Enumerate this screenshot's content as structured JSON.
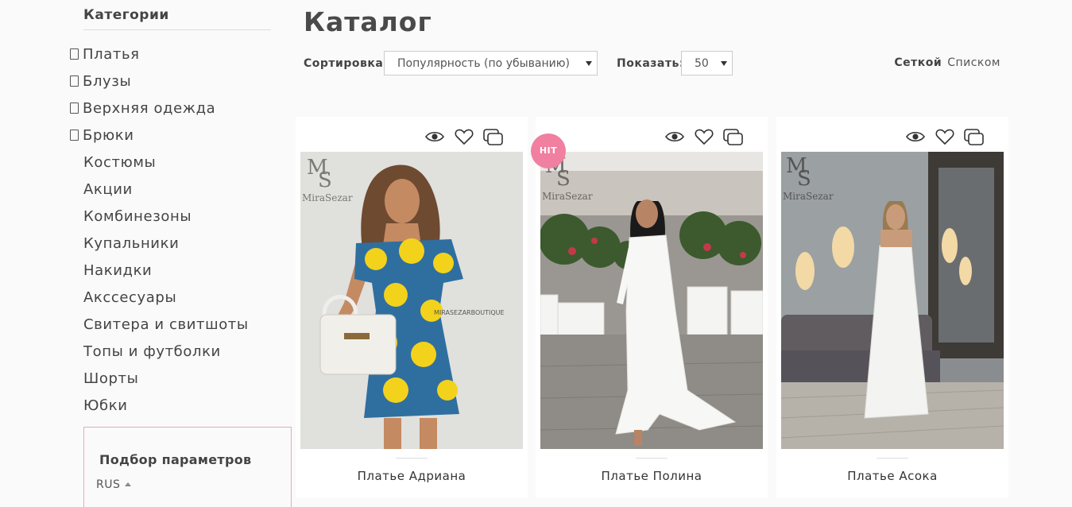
{
  "sidebar": {
    "title": "Категории",
    "items": [
      {
        "label": "Платья",
        "expandable": true
      },
      {
        "label": "Блузы",
        "expandable": true
      },
      {
        "label": "Верхняя одежда",
        "expandable": true
      },
      {
        "label": "Брюки",
        "expandable": true
      },
      {
        "label": "Костюмы",
        "expandable": false
      },
      {
        "label": "Акции",
        "expandable": false
      },
      {
        "label": "Комбинезоны",
        "expandable": false
      },
      {
        "label": "Купальники",
        "expandable": false
      },
      {
        "label": "Накидки",
        "expandable": false
      },
      {
        "label": "Акссесуары",
        "expandable": false
      },
      {
        "label": "Свитера и свитшоты",
        "expandable": false
      },
      {
        "label": "Топы и футболки",
        "expandable": false
      },
      {
        "label": "Шорты",
        "expandable": false
      },
      {
        "label": "Юбки",
        "expandable": false
      }
    ],
    "filter": {
      "title": "Подбор параметров",
      "language": "RUS"
    }
  },
  "main": {
    "title": "Каталог",
    "sort": {
      "label": "Сортировка:",
      "value": "Популярность (по убыванию)"
    },
    "show": {
      "label": "Показать:",
      "value": "50"
    },
    "view": {
      "grid": "Сеткой",
      "list": "Списком",
      "active": "grid"
    },
    "products": [
      {
        "name": "Платье Адриана",
        "badge": "",
        "brand_mark": "MiraSezar",
        "image_caption": "MIRASEZARBOUTIQUE"
      },
      {
        "name": "Платье Полина",
        "badge": "HIT",
        "brand_mark": "MiraSezar"
      },
      {
        "name": "Платье Асока",
        "badge": "",
        "brand_mark": "MiraSezar"
      }
    ]
  },
  "icons": [
    "eye-icon",
    "heart-icon",
    "compare-icon",
    "checkbox-icon",
    "chevron-down-icon"
  ],
  "colors": {
    "accent": "#f07fa0",
    "filter_border": "#e6a9c1",
    "background": "#fafafa"
  }
}
